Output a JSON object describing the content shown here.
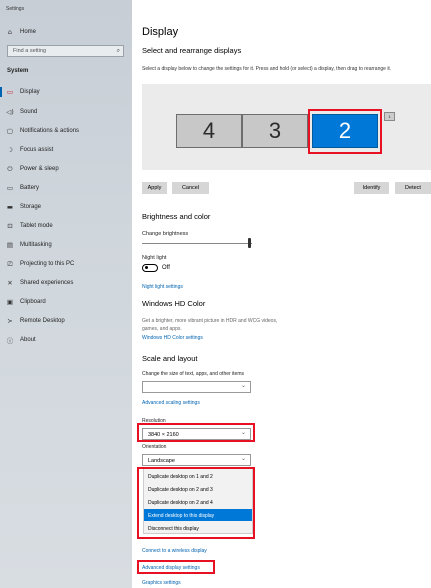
{
  "window": {
    "title": "Settings"
  },
  "sidebar": {
    "home": "Home",
    "search_placeholder": "Find a setting",
    "section": "System",
    "items": [
      {
        "label": "Display",
        "icon": "display-icon"
      },
      {
        "label": "Sound",
        "icon": "sound-icon"
      },
      {
        "label": "Notifications & actions",
        "icon": "notifications-icon"
      },
      {
        "label": "Focus assist",
        "icon": "focus-assist-icon"
      },
      {
        "label": "Power & sleep",
        "icon": "power-icon"
      },
      {
        "label": "Battery",
        "icon": "battery-icon"
      },
      {
        "label": "Storage",
        "icon": "storage-icon"
      },
      {
        "label": "Tablet mode",
        "icon": "tablet-icon"
      },
      {
        "label": "Multitasking",
        "icon": "multitasking-icon"
      },
      {
        "label": "Projecting to this PC",
        "icon": "projecting-icon"
      },
      {
        "label": "Shared experiences",
        "icon": "shared-experiences-icon"
      },
      {
        "label": "Clipboard",
        "icon": "clipboard-icon"
      },
      {
        "label": "Remote Desktop",
        "icon": "remote-desktop-icon"
      },
      {
        "label": "About",
        "icon": "about-icon"
      }
    ]
  },
  "main": {
    "title": "Display",
    "subtitle": "Select and rearrange displays",
    "description": "Select a display below to change the settings for it. Press and hold (or select) a display, then drag to rearrange it.",
    "monitors": [
      "4",
      "3",
      "2",
      "1"
    ],
    "selected_monitor": "2",
    "buttons": {
      "apply": "Apply",
      "cancel": "Cancel",
      "identify": "Identify",
      "detect": "Detect"
    },
    "brightness": {
      "heading": "Brightness and color",
      "label": "Change brightness",
      "value_fraction": 0.95
    },
    "night_light": {
      "label": "Night light",
      "state": "Off",
      "settings_link": "Night light settings"
    },
    "hd_color": {
      "heading": "Windows HD Color",
      "description_line1": "Get a brighter, more vibrant picture in HDR and WCG videos,",
      "description_line2": "games, and apps.",
      "link": "Windows HD Color settings"
    },
    "scale": {
      "heading": "Scale and layout",
      "size_label": "Change the size of text, apps, and other items",
      "size_value": "",
      "advanced_link": "Advanced scaling settings",
      "resolution_label": "Resolution",
      "resolution_value": "3840 × 2160",
      "orientation_label": "Orientation",
      "orientation_value": "Landscape"
    },
    "multiple_displays": {
      "options": [
        "Duplicate desktop on 1 and 2",
        "Duplicate desktop on 2 and 3",
        "Duplicate desktop on 2 and 4",
        "Extend desktop to this display",
        "Disconnect this display"
      ],
      "selected_index": 3
    },
    "links": {
      "wireless": "Connect to a wireless display",
      "advanced_display": "Advanced display settings",
      "graphics": "Graphics settings"
    },
    "colors": {
      "accent": "#0078d7",
      "highlight": "#e81123",
      "link": "#0063b1"
    }
  }
}
